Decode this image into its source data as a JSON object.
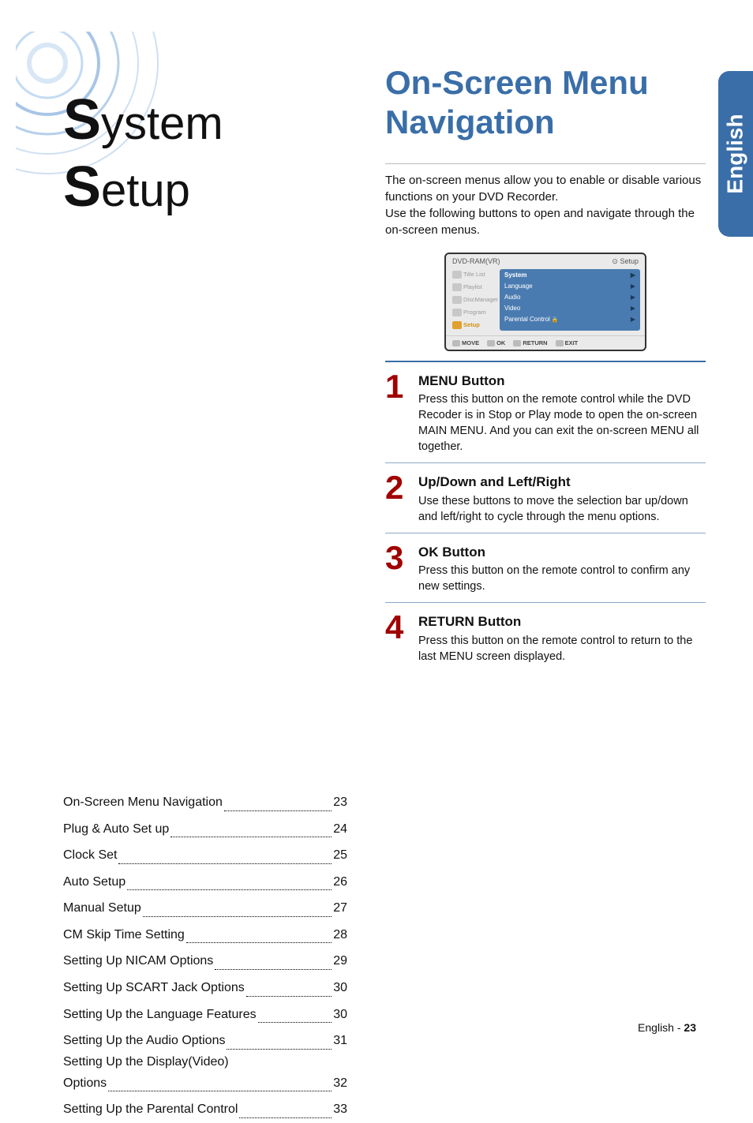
{
  "side_tab_label": "English",
  "section_title_line1_first": "S",
  "section_title_line1_rest": "ystem",
  "section_title_line2_first": "S",
  "section_title_line2_rest": "etup",
  "right_title_line1": "On-Screen Menu",
  "right_title_line2": "Navigation",
  "intro_text": "The on-screen menus allow you to enable or disable various functions on your DVD Recorder.\nUse the following buttons to open and navigate through the on-screen menus.",
  "osd": {
    "top_left": "DVD-RAM(VR)",
    "top_right_icon": "⊙",
    "top_right_label": "Setup",
    "left_items": [
      "Title List",
      "Playlist",
      "DiscManager",
      "Program",
      "Setup"
    ],
    "right_options": [
      "System",
      "Language",
      "Audio",
      "Video",
      "Parental Control"
    ],
    "bottom": [
      "MOVE",
      "OK",
      "RETURN",
      "EXIT"
    ]
  },
  "steps": [
    {
      "num": "1",
      "heading": "MENU Button",
      "body": "Press this button on the remote control while the DVD Recoder is in Stop or Play mode to open the on-screen MAIN MENU. And you can exit the on-screen MENU all together."
    },
    {
      "num": "2",
      "heading": "Up/Down and Left/Right",
      "body": "Use these buttons to move the selection bar up/down and left/right to cycle through the menu options."
    },
    {
      "num": "3",
      "heading": "OK Button",
      "body": "Press this button on the remote control to confirm any new settings."
    },
    {
      "num": "4",
      "heading": "RETURN Button",
      "body": "Press this button on the remote control to return to the last MENU screen displayed."
    }
  ],
  "toc": [
    {
      "label": "On-Screen Menu Navigation",
      "page": "23"
    },
    {
      "label": "Plug & Auto Set up",
      "page": "24"
    },
    {
      "label": "Clock Set",
      "page": "25"
    },
    {
      "label": "Auto Setup",
      "page": "26"
    },
    {
      "label": "Manual Setup",
      "page": "27"
    },
    {
      "label": "CM Skip Time Setting",
      "page": "28"
    },
    {
      "label": "Setting Up NICAM Options",
      "page": "29"
    },
    {
      "label": "Setting Up SCART Jack Options",
      "page": "30"
    },
    {
      "label": "Setting Up the Language Features",
      "page": "30"
    },
    {
      "label": "Setting Up the Audio Options",
      "page": "31"
    },
    {
      "label": "Setting Up the Display(Video) Options",
      "page": "32",
      "multiline": true
    },
    {
      "label": "Setting Up the Parental Control",
      "page": "33"
    }
  ],
  "footer_lang": "English",
  "footer_sep": " - ",
  "footer_page": "23"
}
